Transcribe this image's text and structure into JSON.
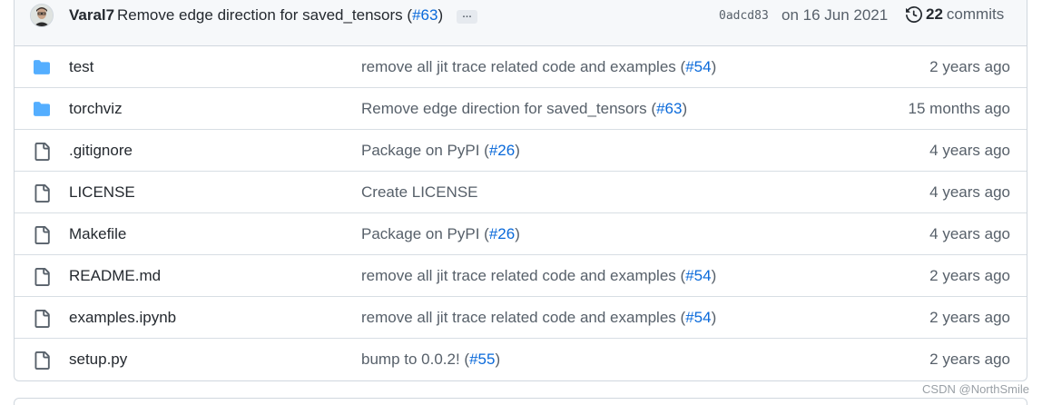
{
  "latest_commit": {
    "author": "Varal7",
    "message": "Remove edge direction for saved_tensors (",
    "pr_link": "#63",
    "message_close": ")",
    "ellipsis": "…",
    "sha": "0adcd83",
    "date": "on 16 Jun 2021",
    "commit_count": "22",
    "commits_label": "commits"
  },
  "files": [
    {
      "type": "folder",
      "name": "test",
      "msg": "remove all jit trace related code and examples (",
      "pr": "#54",
      "close": ")",
      "age": "2 years ago"
    },
    {
      "type": "folder",
      "name": "torchviz",
      "msg": "Remove edge direction for saved_tensors (",
      "pr": "#63",
      "close": ")",
      "age": "15 months ago"
    },
    {
      "type": "file",
      "name": ".gitignore",
      "msg": "Package on PyPI (",
      "pr": "#26",
      "close": ")",
      "age": "4 years ago"
    },
    {
      "type": "file",
      "name": "LICENSE",
      "msg": "Create LICENSE",
      "pr": "",
      "close": "",
      "age": "4 years ago"
    },
    {
      "type": "file",
      "name": "Makefile",
      "msg": "Package on PyPI (",
      "pr": "#26",
      "close": ")",
      "age": "4 years ago"
    },
    {
      "type": "file",
      "name": "README.md",
      "msg": "remove all jit trace related code and examples (",
      "pr": "#54",
      "close": ")",
      "age": "2 years ago"
    },
    {
      "type": "file",
      "name": "examples.ipynb",
      "msg": "remove all jit trace related code and examples (",
      "pr": "#54",
      "close": ")",
      "age": "2 years ago"
    },
    {
      "type": "file",
      "name": "setup.py",
      "msg": "bump to 0.0.2! (",
      "pr": "#55",
      "close": ")",
      "age": "2 years ago"
    }
  ],
  "watermark": "CSDN @NorthSmile",
  "colors": {
    "folder": "#54aeff",
    "link": "#0969da",
    "muted": "#57606a"
  }
}
